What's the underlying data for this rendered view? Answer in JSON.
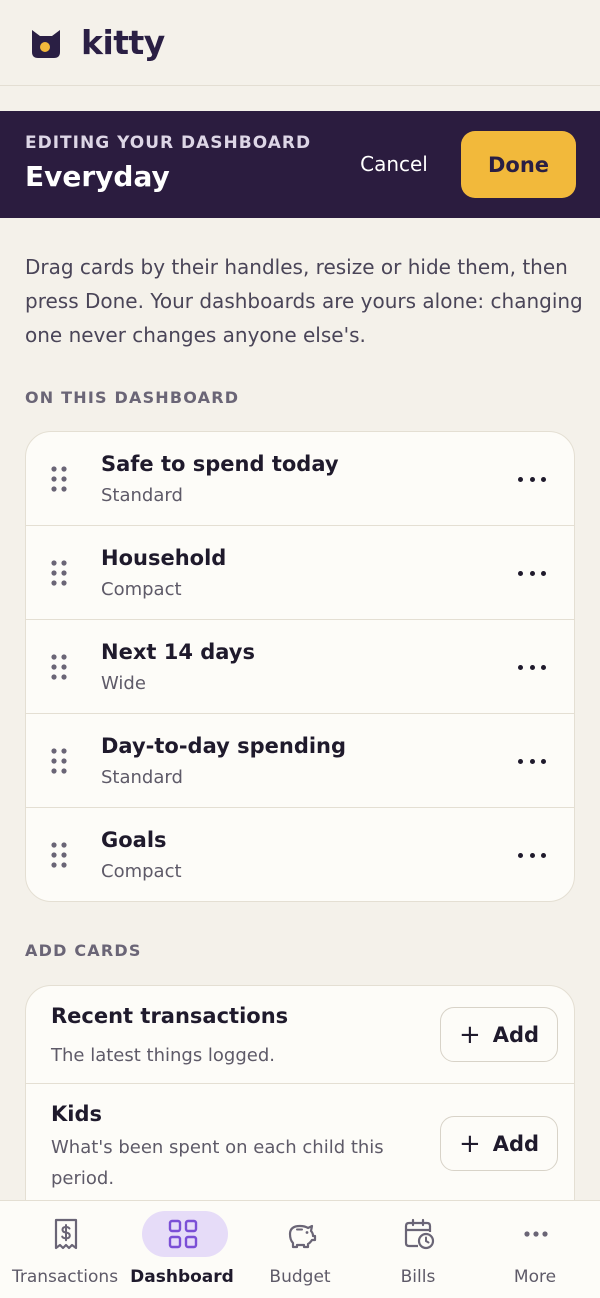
{
  "app": {
    "brand": "kitty"
  },
  "edit_banner": {
    "kicker": "EDITING YOUR DASHBOARD",
    "title": "Everyday",
    "cancel_label": "Cancel",
    "done_label": "Done"
  },
  "helper_text": "Drag cards by their handles, resize or hide them, then press Done. Your dashboards are yours alone: changing one never changes anyone else's.",
  "sections": {
    "on_dashboard": "ON THIS DASHBOARD",
    "add_cards": "ADD CARDS"
  },
  "dashboard_cards": [
    {
      "name": "Safe to spend today",
      "size": "Standard"
    },
    {
      "name": "Household",
      "size": "Compact"
    },
    {
      "name": "Next 14 days",
      "size": "Wide"
    },
    {
      "name": "Day-to-day spending",
      "size": "Standard"
    },
    {
      "name": "Goals",
      "size": "Compact"
    }
  ],
  "add_cards": [
    {
      "name": "Recent transactions",
      "description": "The latest things logged.",
      "button_label": "Add"
    },
    {
      "name": "Kids",
      "description": "What's been spent on each child this period.",
      "button_label": "Add"
    }
  ],
  "nav": [
    {
      "label": "Transactions",
      "icon": "receipt-dollar-icon",
      "active": false
    },
    {
      "label": "Dashboard",
      "icon": "dashboard-grid-icon",
      "active": true
    },
    {
      "label": "Budget",
      "icon": "piggy-bank-icon",
      "active": false
    },
    {
      "label": "Bills",
      "icon": "calendar-clock-icon",
      "active": false
    },
    {
      "label": "More",
      "icon": "more-dots-icon",
      "active": false
    }
  ],
  "colors": {
    "banner": "#2b1c3f",
    "accent": "#f2b93b",
    "active_nav": "#e6dcf8",
    "background": "#f4f1ea"
  }
}
